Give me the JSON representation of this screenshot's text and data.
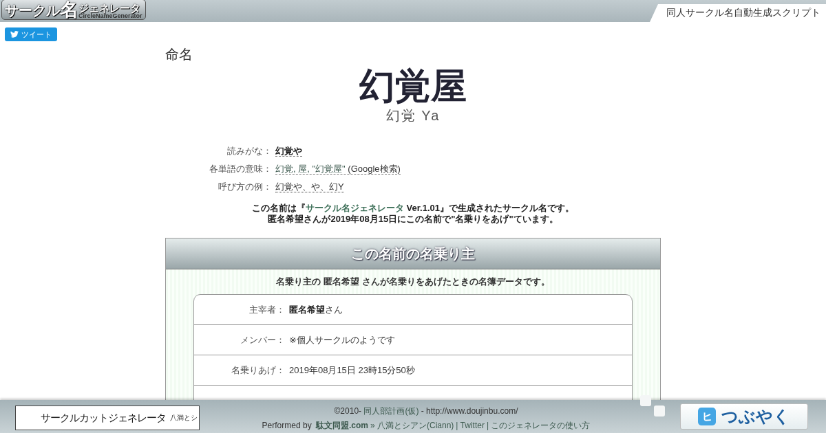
{
  "header": {
    "logo": {
      "title_a": "サークル",
      "title_b": "名",
      "title_c": "ジェネレータ",
      "subtitle": "CircleNameGenerator"
    },
    "tagline": "同人サークル名自動生成スクリプト"
  },
  "tweet_button": {
    "label": "ツイート"
  },
  "section_label": "命名",
  "name": {
    "main": "幻覚屋",
    "reading": "幻覚 Ya"
  },
  "details": [
    {
      "label": "読みがな：",
      "kind": "bold",
      "parts": [
        "幻覚や"
      ]
    },
    {
      "label": "各単語の意味：",
      "kind": "links",
      "parts": [
        "幻覚, 屋, \"幻覚屋\""
      ],
      "suffix": "(Google検索)"
    },
    {
      "label": "呼び方の例：",
      "kind": "dotted",
      "parts": [
        "幻覚や、や、幻Y"
      ]
    }
  ],
  "note": {
    "before": "この名前は『",
    "link": "サークル名ジェネレータ",
    "after": " Ver.1.01』で生成されたサークル名です。",
    "line2": "匿名希望さんが2019年08月15日にこの名前で\"名乗りをあげ\"ています。"
  },
  "owner_panel": {
    "title": "この名前の名乗り主",
    "intro": "名乗り主の 匿名希望 さんが名乗りをあげたときの名簿データです。",
    "rows": [
      {
        "label": "主宰者：",
        "value": "**匿名希望**さん"
      },
      {
        "label": "メンバー：",
        "value": "※個人サークルのようです"
      },
      {
        "label": "名乗りあげ：",
        "value": "2019年08月15日 23時15分50秒"
      }
    ]
  },
  "footer": {
    "banner": {
      "title": "サークルカットジェネレータ",
      "side": "八満とシ"
    },
    "copyright": "©2010-",
    "org_link": "同人部計画(仮)",
    "url": "- http://www.doujinbu.com/",
    "performed": "Performed by",
    "links": [
      {
        "text": "駄文同盟.com",
        "bold": true
      },
      {
        "text": "» 八満とシアン(Ciann)",
        "bold": false
      },
      {
        "text": "| Twitter",
        "bold": false
      },
      {
        "text": "| このジェネレータの使い方",
        "bold": false
      }
    ],
    "share_button": {
      "icon": "ヒ",
      "label": "つぶやく"
    }
  }
}
